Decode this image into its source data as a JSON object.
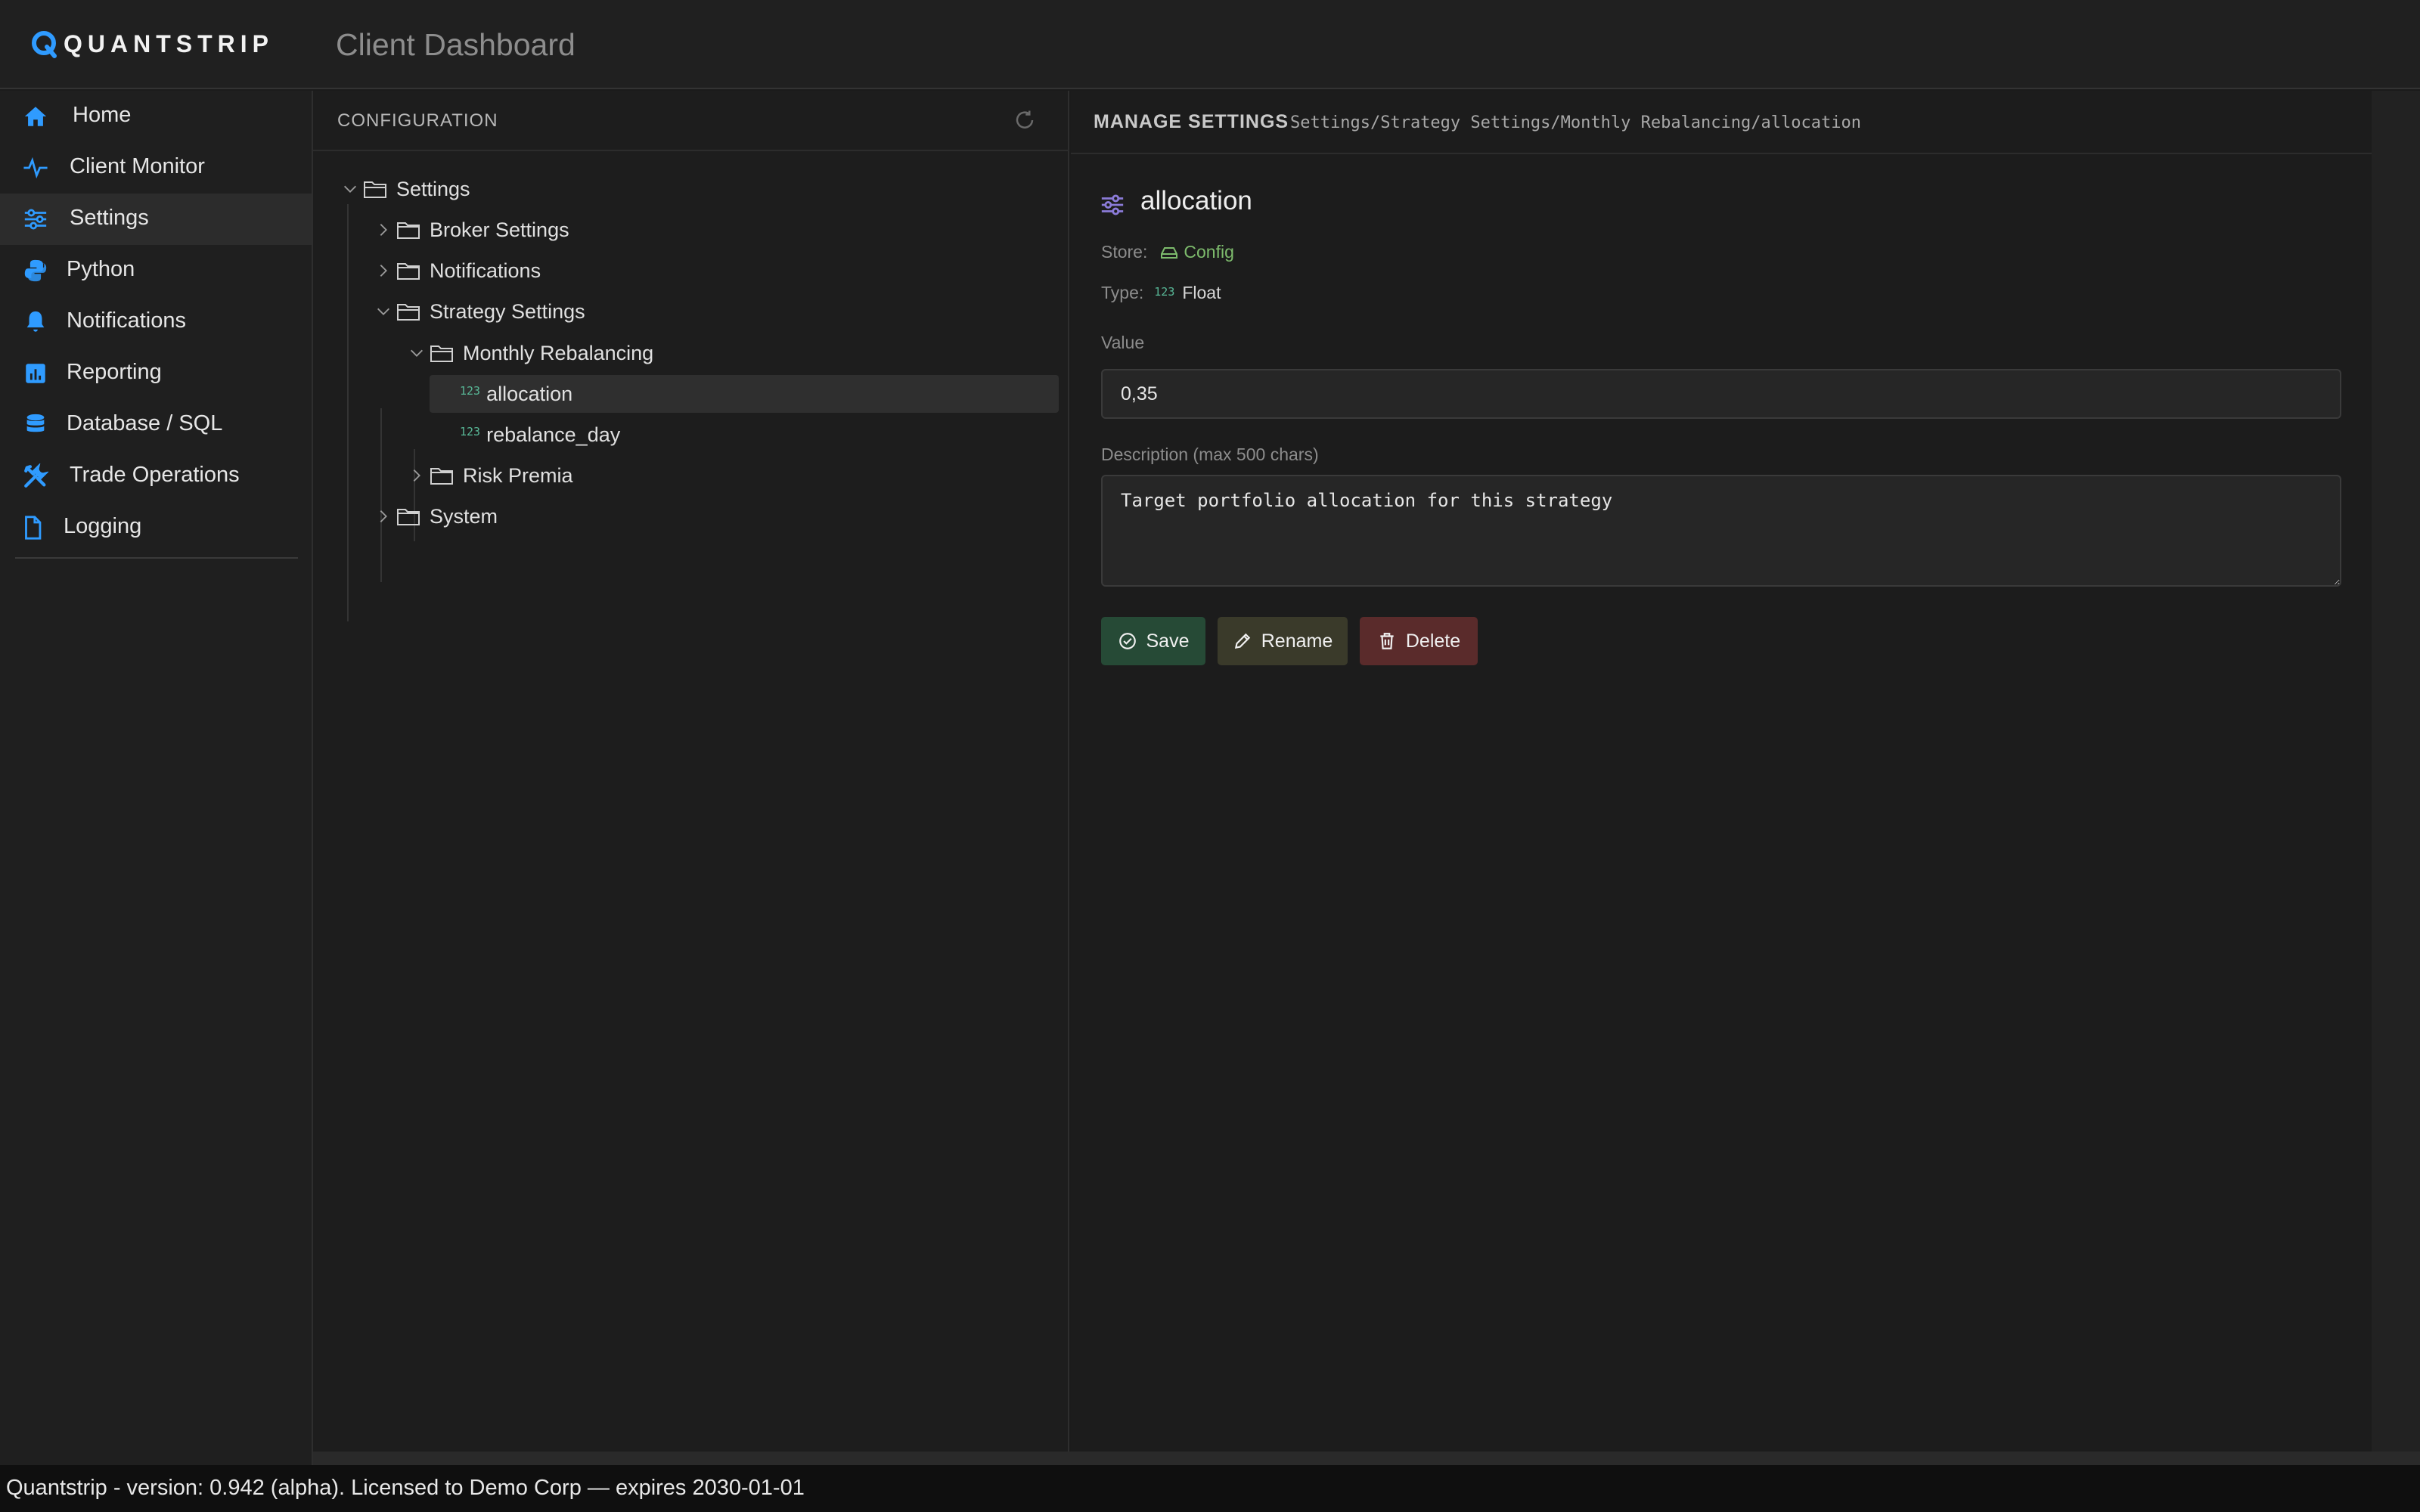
{
  "brand": {
    "logo_text": "QUANTSTRIP",
    "accent": "#2f9bff"
  },
  "header": {
    "title": "Client Dashboard"
  },
  "sidebar": {
    "items": [
      {
        "label": "Home",
        "icon": "home-icon"
      },
      {
        "label": "Client Monitor",
        "icon": "pulse-icon"
      },
      {
        "label": "Settings",
        "icon": "sliders-icon",
        "active": true
      },
      {
        "label": "Python",
        "icon": "python-icon"
      },
      {
        "label": "Notifications",
        "icon": "bell-icon"
      },
      {
        "label": "Reporting",
        "icon": "chart-icon"
      },
      {
        "label": "Database / SQL",
        "icon": "database-icon"
      },
      {
        "label": "Trade Operations",
        "icon": "tools-icon"
      },
      {
        "label": "Logging",
        "icon": "file-icon"
      }
    ]
  },
  "config": {
    "title": "CONFIGURATION",
    "tree": {
      "root": "Settings",
      "broker": "Broker Settings",
      "notifications": "Notifications",
      "strategy": "Strategy Settings",
      "monthly": "Monthly Rebalancing",
      "allocation": "allocation",
      "rebalance_day": "rebalance_day",
      "risk_premia": "Risk Premia",
      "system": "System",
      "number_badge": "123"
    }
  },
  "manage": {
    "title": "MANAGE SETTINGS",
    "breadcrumb": "Settings/Strategy Settings/Monthly Rebalancing/allocation",
    "setting_name": "allocation",
    "store_label": "Store:",
    "store_value": "Config",
    "type_label": "Type:",
    "type_value": "Float",
    "value_label": "Value",
    "value": "0,35",
    "description_label": "Description (max 500 chars)",
    "description": "Target portfolio allocation for this strategy",
    "save_label": "Save",
    "rename_label": "Rename",
    "delete_label": "Delete"
  },
  "colors": {
    "save": "#264a36",
    "rename": "#3a3a2a",
    "delete": "#5a2b2b",
    "store_green": "#7dbb6c"
  },
  "footer": {
    "text": "Quantstrip - version: 0.942 (alpha). Licensed to Demo Corp — expires 2030-01-01"
  }
}
